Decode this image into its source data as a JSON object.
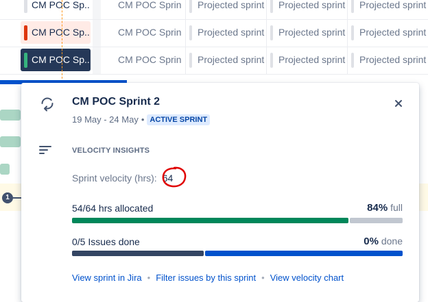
{
  "timeline": {
    "rows": [
      {
        "name": "CM POC Sp...",
        "cols": [
          "CM POC Sprin...",
          "Projected sprint",
          "Projected sprint",
          "Projected sprint"
        ]
      },
      {
        "name": "CM POC Sp...",
        "cols": [
          "CM POC Sprin...",
          "Projected sprint",
          "Projected sprint",
          "Projected sprint"
        ]
      },
      {
        "name": "CM POC Sp...",
        "cols": [
          "CM POC Sprin...",
          "Projected sprint",
          "Projected sprint",
          "Projected sprint"
        ]
      }
    ],
    "today_badge": "1"
  },
  "popup": {
    "title": "CM POC Sprint 2",
    "date_range": "19 May - 24 May",
    "separator": "•",
    "status": "ACTIVE SPRINT",
    "section_title": "VELOCITY INSIGHTS",
    "velocity_label": "Sprint velocity (hrs):",
    "velocity_value": "64",
    "allocated_label": "54/64 hrs allocated",
    "allocated_pct": "84%",
    "allocated_suffix": "full",
    "allocated_fraction": 0.84,
    "issues_label": "0/5 Issues done",
    "issues_pct": "0%",
    "issues_suffix": "done",
    "issues_done_fraction": 0.0,
    "issues_in_progress_fraction": 0.4,
    "links": [
      "View sprint in Jira",
      "Filter issues by this sprint",
      "View velocity chart"
    ],
    "icons": {
      "sprint": "sprint-cycle-icon",
      "insights": "list-lines-icon",
      "close": "close-icon"
    }
  },
  "colors": {
    "allocated": "#00875a",
    "remaining": "#c1c7d0",
    "issue_todo": "#344563",
    "issue_progress": "#0052cc",
    "link": "#0052cc",
    "lozenge_bg": "#deebff",
    "lozenge_text": "#0747a6",
    "annotation": "#e00000"
  }
}
